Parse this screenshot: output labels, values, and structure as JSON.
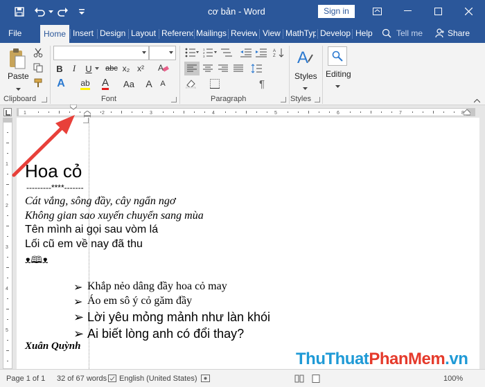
{
  "window": {
    "title": "cơ bản  -  Word",
    "signin_label": "Sign in"
  },
  "tabs": [
    {
      "label": "File"
    },
    {
      "label": "Home",
      "active": true
    },
    {
      "label": "Insert"
    },
    {
      "label": "Design"
    },
    {
      "label": "Layout"
    },
    {
      "label": "Referenc"
    },
    {
      "label": "Mailings"
    },
    {
      "label": "Review"
    },
    {
      "label": "View"
    },
    {
      "label": "MathTyp"
    },
    {
      "label": "Develop"
    },
    {
      "label": "Help"
    }
  ],
  "tell_me": "Tell me",
  "share": "Share",
  "ribbon": {
    "clipboard": {
      "paste": "Paste",
      "label": "Clipboard"
    },
    "font": {
      "label": "Font",
      "font_name": "",
      "font_size": "",
      "bold": "B",
      "italic": "I",
      "underline": "U",
      "strike": "abc",
      "subscript": "x₂",
      "superscript": "x²",
      "text_effects": "A",
      "highlight": "ab",
      "font_color": "A",
      "change_case": "Aa",
      "grow": "A",
      "shrink": "A"
    },
    "paragraph": {
      "label": "Paragraph"
    },
    "styles": {
      "button": "Styles",
      "label": "Styles"
    },
    "editing": {
      "button": "Editing"
    }
  },
  "document": {
    "title": "Hoa cỏ",
    "separator": "---------****-------",
    "lines": [
      "Cát vắng, sông đầy, cây ngẩn ngơ",
      "Không gian sao xuyến chuyển sang mùa",
      "Tên mình ai gọi sau vòm lá",
      "Lối cũ em về nay đã thu"
    ],
    "symbols": "ᴥ🕮ᴥ",
    "bullets": [
      "Khắp nẻo dâng đầy hoa cỏ may",
      "Áo em sô ý cỏ găm đầy",
      "Lời yêu mỏng mảnh như làn khói",
      "Ai biết lòng anh có đổi thay?"
    ],
    "bullet_mark": "➢",
    "author": "Xuân Quỳnh"
  },
  "status": {
    "page": "Page 1 of 1",
    "words": "32 of 67 words",
    "language": "English (United States)",
    "zoom": "100%"
  },
  "watermark": {
    "part1": "ThuThuat",
    "part2": "PhanMem",
    "part3": ".vn"
  },
  "colors": {
    "titlebar": "#2b579a",
    "arrow": "#e8403a"
  }
}
